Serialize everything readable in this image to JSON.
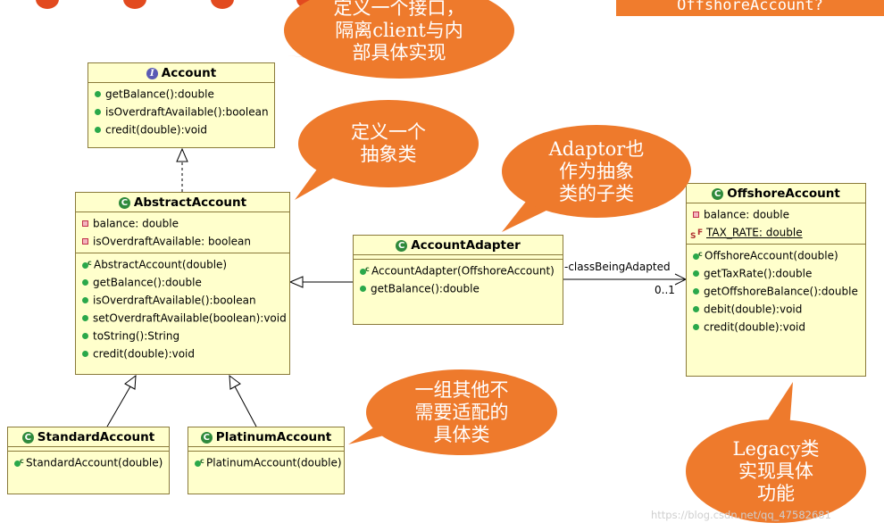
{
  "banner": {
    "text": "OffshoreAccount?"
  },
  "colors": {
    "class_fill": "#ffffcc",
    "class_border": "#8a7a3a",
    "callout": "#ee7a2c",
    "dot": "#e24a1f"
  },
  "classes": {
    "account": {
      "name": "Account",
      "methods": [
        "getBalance():double",
        "isOverdraftAvailable():boolean",
        "credit(double):void"
      ]
    },
    "abstract_account": {
      "name": "AbstractAccount",
      "fields": [
        "balance: double",
        "isOverdraftAvailable: boolean"
      ],
      "methods": [
        "AbstractAccount(double)",
        "getBalance():double",
        "isOverdraftAvailable():boolean",
        "setOverdraftAvailable(boolean):void",
        "toString():String",
        "credit(double):void"
      ]
    },
    "account_adapter": {
      "name": "AccountAdapter",
      "methods": [
        "AccountAdapter(OffshoreAccount)",
        "getBalance():double"
      ]
    },
    "offshore_account": {
      "name": "OffshoreAccount",
      "fields": [
        "balance: double",
        "TAX_RATE: double"
      ],
      "methods": [
        "OffshoreAccount(double)",
        "getTaxRate():double",
        "getOffshoreBalance():double",
        "debit(double):void",
        "credit(double):void"
      ]
    },
    "standard_account": {
      "name": "StandardAccount",
      "methods": [
        "StandardAccount(double)"
      ]
    },
    "platinum_account": {
      "name": "PlatinumAccount",
      "methods": [
        "PlatinumAccount(double)"
      ]
    }
  },
  "association": {
    "role": "-classBeingAdapted",
    "multiplicity": "0..1"
  },
  "callouts": {
    "interface": "定义一个接口，\n隔离client与内\n部具体实现",
    "abstract": "定义一个\n抽象类",
    "adaptor": "Adaptor也\n作为抽象\n类的子类",
    "others": "一组其他不\n需要适配的\n具体类",
    "legacy": "Legacy类\n实现具体\n功能"
  },
  "watermark": "https://blog.csdn.net/qq_47582681"
}
